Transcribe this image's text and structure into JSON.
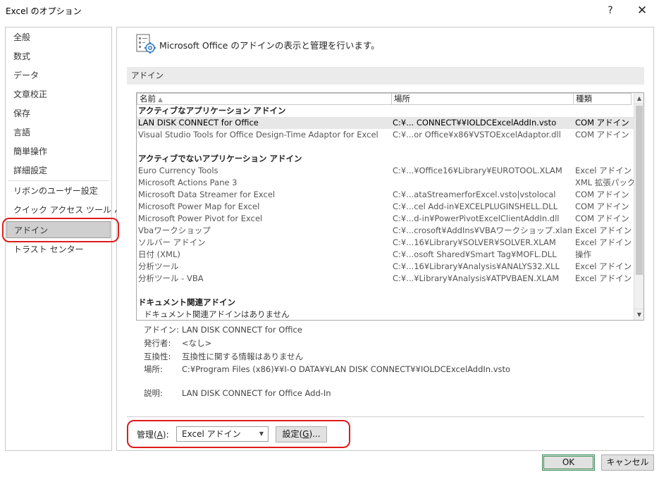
{
  "window": {
    "title": "Excel のオプション",
    "help_icon": "question-mark-icon",
    "help_glyph": "?",
    "close_icon": "close-icon",
    "close_glyph": "✕"
  },
  "nav": {
    "items": [
      {
        "label": "全般"
      },
      {
        "label": "数式"
      },
      {
        "label": "データ"
      },
      {
        "label": "文章校正"
      },
      {
        "label": "保存"
      },
      {
        "label": "言語"
      },
      {
        "label": "簡単操作"
      },
      {
        "label": "詳細設定"
      },
      {
        "label": "リボンのユーザー設定"
      },
      {
        "label": "クイック アクセス ツール バー"
      },
      {
        "label": "アドイン",
        "selected": true
      },
      {
        "label": "トラスト センター"
      }
    ]
  },
  "header": {
    "text": "Microsoft Office のアドインの表示と管理を行います。",
    "icon": "addins-icon"
  },
  "section": {
    "title": "アドイン"
  },
  "list": {
    "columns": {
      "name": "名前",
      "location": "場所",
      "type": "種類"
    },
    "sort_glyph": "▲",
    "groups": [
      {
        "title": "アクティブなアプリケーション アドイン",
        "rows": [
          {
            "name": "LAN DISK CONNECT for Office",
            "location": "C:¥... CONNECT¥¥IOLDCExcelAddIn.vsto",
            "type": "COM アドイン",
            "selected": true
          },
          {
            "name": "Visual Studio Tools for Office Design-Time Adaptor for Excel",
            "location": "C:¥...or Office¥x86¥VSTOExcelAdaptor.dll",
            "type": "COM アドイン"
          }
        ]
      },
      {
        "title": "アクティブでないアプリケーション アドイン",
        "rows": [
          {
            "name": "Euro Currency Tools",
            "location": "C:¥...¥Office16¥Library¥EUROTOOL.XLAM",
            "type": "Excel アドイン"
          },
          {
            "name": "Microsoft Actions Pane 3",
            "location": "",
            "type": "XML 拡張パック"
          },
          {
            "name": "Microsoft Data Streamer for Excel",
            "location": "C:¥...ataStreamerforExcel.vsto|vstolocal",
            "type": "COM アドイン"
          },
          {
            "name": "Microsoft Power Map for Excel",
            "location": "C:¥...cel Add-in¥EXCELPLUGINSHELL.DLL",
            "type": "COM アドイン"
          },
          {
            "name": "Microsoft Power Pivot for Excel",
            "location": "C:¥...d-in¥PowerPivotExcelClientAddIn.dll",
            "type": "COM アドイン"
          },
          {
            "name": "Vbaワークショップ",
            "location": "C:¥...crosoft¥AddIns¥VBAワークショップ.xlam",
            "type": "Excel アドイン"
          },
          {
            "name": "ソルバー アドイン",
            "location": "C:¥...16¥Library¥SOLVER¥SOLVER.XLAM",
            "type": "Excel アドイン"
          },
          {
            "name": "日付 (XML)",
            "location": "C:¥...osoft Shared¥Smart Tag¥MOFL.DLL",
            "type": "操作"
          },
          {
            "name": "分析ツール",
            "location": "C:¥...16¥Library¥Analysis¥ANALYS32.XLL",
            "type": "Excel アドイン"
          },
          {
            "name": "分析ツール - VBA",
            "location": "C:¥...¥Library¥Analysis¥ATPVBAEN.XLAM",
            "type": "Excel アドイン"
          }
        ]
      },
      {
        "title": "ドキュメント関連アドイン",
        "empty_text": "ドキュメント関連アドインはありません"
      }
    ]
  },
  "details": {
    "addin_label": "アドイン:",
    "addin_value": "LAN DISK CONNECT for Office",
    "publisher_label": "発行者:",
    "publisher_value": "<なし>",
    "compat_label": "互換性:",
    "compat_value": "互換性に関する情報はありません",
    "location_label": "場所:",
    "location_value": "C:¥Program Files (x86)¥¥I-O DATA¥¥LAN DISK CONNECT¥¥IOLDCExcelAddIn.vsto",
    "desc_label": "説明:",
    "desc_value": "LAN DISK CONNECT for Office Add-In"
  },
  "manage": {
    "label": "管理(A):",
    "label_prefix": "管理(",
    "label_key": "A",
    "label_suffix": "):",
    "selected": "Excel アドイン",
    "go_prefix": "設定(",
    "go_key": "G",
    "go_suffix": ")..."
  },
  "footer": {
    "ok": "OK",
    "cancel": "キャンセル"
  },
  "colors": {
    "highlight": "#e01b1b",
    "selected_nav": "#cfcfcf",
    "ok_border": "#3d8f5a"
  }
}
